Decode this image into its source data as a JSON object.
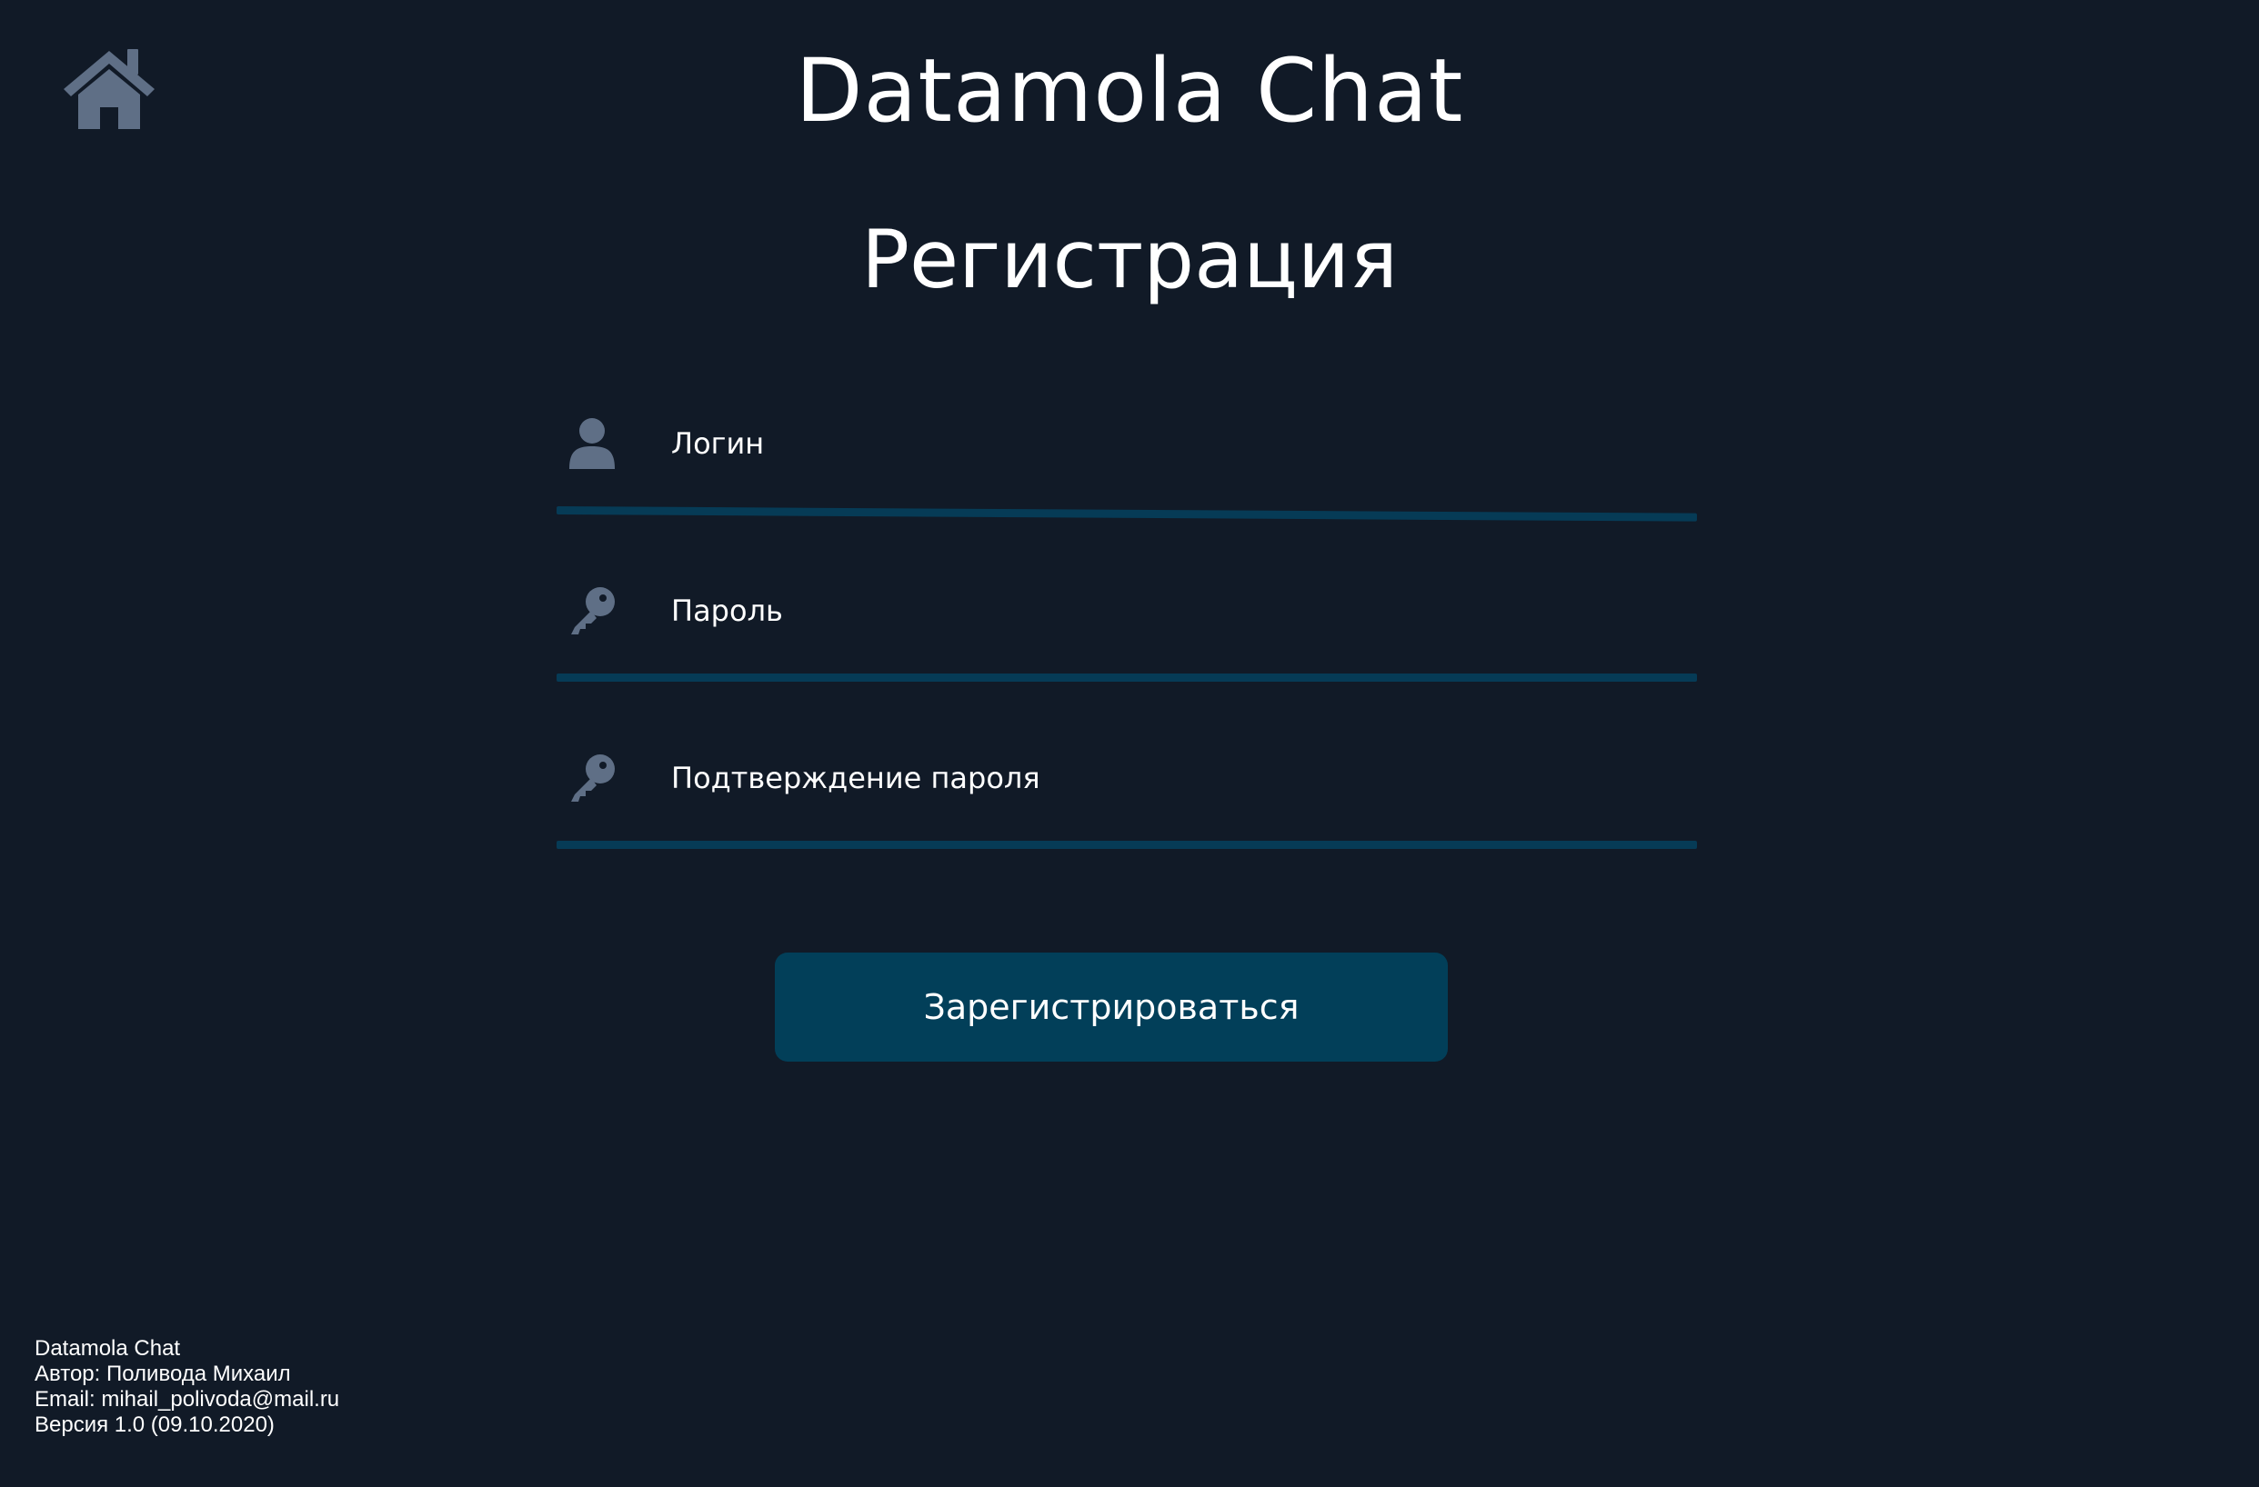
{
  "header": {
    "app_title": "Datamola Chat",
    "home_icon": "home-icon"
  },
  "page": {
    "title": "Регистрация"
  },
  "form": {
    "fields": [
      {
        "id": "login",
        "placeholder": "Логин",
        "value": "",
        "icon": "user-icon"
      },
      {
        "id": "password",
        "placeholder": "Пароль",
        "value": "",
        "icon": "key-icon"
      },
      {
        "id": "password_confirm",
        "placeholder": "Подтверждение пароля",
        "value": "",
        "icon": "key-icon"
      }
    ],
    "submit_label": "Зарегистрироваться"
  },
  "footer": {
    "app_name": "Datamola Chat",
    "author": "Автор: Поливода Михаил",
    "email": "Email: mihail_polivoda@mail.ru",
    "version": "Версия 1.0 (09.10.2020)"
  },
  "colors": {
    "background": "#111a27",
    "accent": "#023f59",
    "underline": "#063b56",
    "icon": "#5f6f86",
    "text": "#ffffff"
  }
}
